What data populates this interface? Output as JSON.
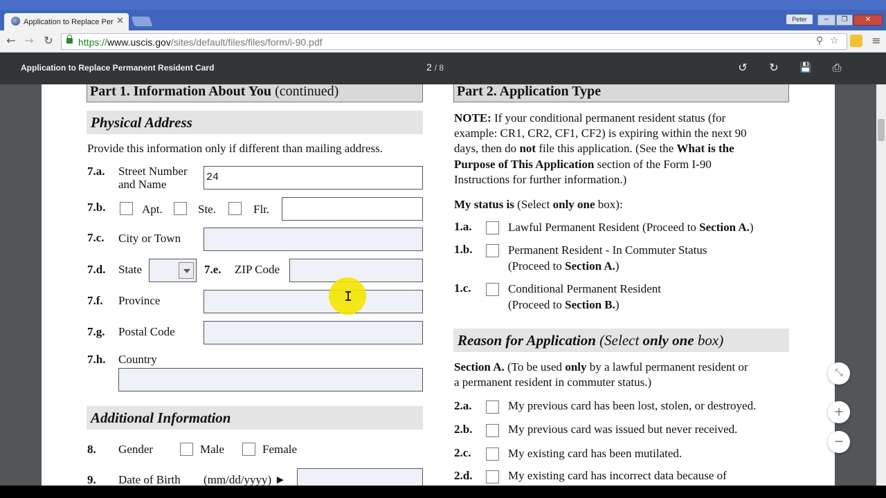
{
  "browser": {
    "tab_title": "Application to Replace Per",
    "tab_close": "✕",
    "profile_name": "Peter",
    "url_scheme": "https://",
    "url_host": "www.uscis.gov",
    "url_path": "/sites/default/files/files/form/i-90.pdf",
    "back_glyph": "←",
    "forward_glyph": "→",
    "reload_glyph": "↻",
    "zoom_glyph": "⚲",
    "star_glyph": "☆",
    "menu_glyph": "≡",
    "min_glyph": "−",
    "max_glyph": "❐",
    "close_glyph": "✕"
  },
  "pdf": {
    "doc_title": "Application to Replace Permanent Resident Card",
    "page_current": "2",
    "page_total": "/ 8",
    "rotate_ccw_glyph": "↺",
    "rotate_cw_glyph": "↻",
    "save_glyph": "💾",
    "print_glyph": "⎙",
    "fit_glyph": "⤡",
    "zoom_in_glyph": "+",
    "zoom_out_glyph": "−"
  },
  "part1": {
    "title_bold": "Part 1.  Information About You",
    "title_light": " (continued)",
    "physical_address_heading": "Physical Address",
    "provide_note": "Provide this information only if different than mailing address.",
    "street_num": "7.a.",
    "street_label_1": "Street Number",
    "street_label_2": "and Name",
    "street_value": "24",
    "unit_num": "7.b.",
    "apt_label": "Apt.",
    "ste_label": "Ste.",
    "flr_label": "Flr.",
    "city_num": "7.c.",
    "city_label": "City or Town",
    "state_num": "7.d.",
    "state_label": "State",
    "zip_num": "7.e.",
    "zip_label": "ZIP Code",
    "province_num": "7.f.",
    "province_label": "Province",
    "postal_num": "7.g.",
    "postal_label": "Postal Code",
    "country_num": "7.h.",
    "country_label": "Country",
    "additional_info_heading": "Additional Information",
    "gender_num": "8.",
    "gender_label": "Gender",
    "male_label": "Male",
    "female_label": "Female",
    "dob_num": "9.",
    "dob_label": "Date of Birth",
    "dob_format": "(mm/dd/yyyy) ►"
  },
  "part2": {
    "title": "Part 2.  Application Type",
    "note_label": "NOTE:",
    "note_line1": " If your conditional permanent resident status (for",
    "note_line2": "example:  CR1, CR2, CF1, CF2) is expiring within the next 90",
    "note_line3a": "days, then do ",
    "note_line3b": "not",
    "note_line3c": " file this application.  (See the ",
    "note_line3d": "What is the",
    "note_line4a": "Purpose of This Application",
    "note_line4b": " section of the Form I-90",
    "note_line5": "Instructions for further information.)",
    "status_a": "My status is",
    "status_b": " (Select ",
    "status_c": "only one",
    "status_d": " box):",
    "opt1_num": "1.a.",
    "opt1_text": "Lawful Permanent Resident (Proceed to ",
    "opt1_bold": "Section A.",
    "opt1_end": ")",
    "opt2_num": "1.b.",
    "opt2_line1": "Permanent Resident - In Commuter Status",
    "opt2_line2a": "(Proceed to ",
    "opt2_line2b": "Section A.",
    "opt2_line2c": ")",
    "opt3_num": "1.c.",
    "opt3_line1": "Conditional Permanent Resident",
    "opt3_line2a": "(Proceed to ",
    "opt3_line2b": "Section B.",
    "opt3_line2c": ")",
    "reason_heading_a": "Reason for Application",
    "reason_heading_b": " (Select ",
    "reason_heading_c": "only one",
    "reason_heading_d": " box)",
    "secA_label": "Section A.",
    "secA_line1a": "  (To be used ",
    "secA_line1b": "only",
    "secA_line1c": " by a lawful permanent resident or",
    "secA_line2": "a permanent resident in commuter status.)",
    "r1_num": "2.a.",
    "r1_text": "My previous card has been lost, stolen, or destroyed.",
    "r2_num": "2.b.",
    "r2_text": "My previous card was issued but never received.",
    "r3_num": "2.c.",
    "r3_text": "My existing card has been mutilated.",
    "r4_num": "2.d.",
    "r4_text": "My existing card has incorrect data because of"
  }
}
